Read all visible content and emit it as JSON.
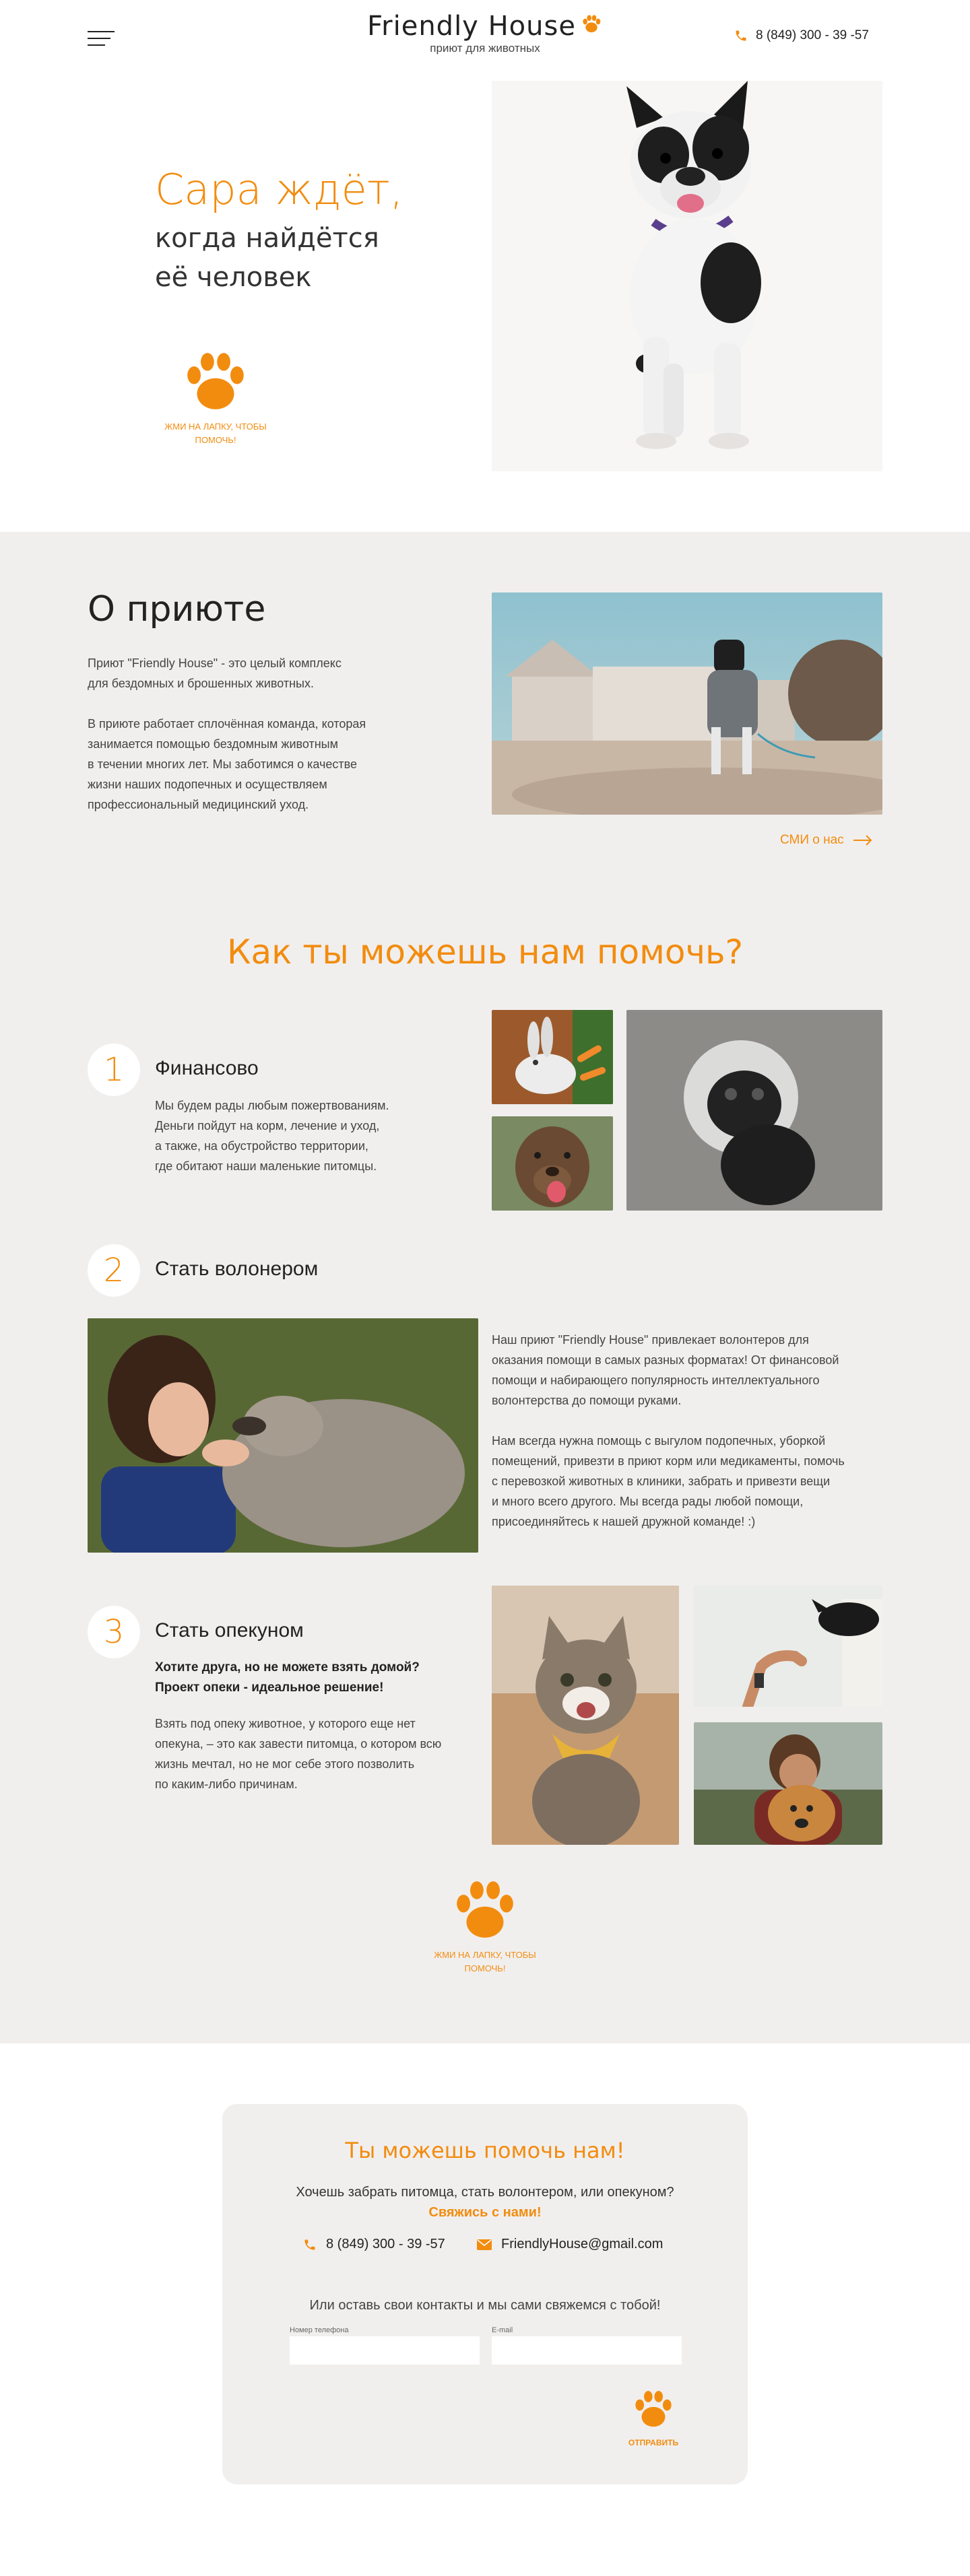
{
  "header": {
    "logo_title": "Friendly House",
    "logo_subtitle": "приют для животных",
    "phone": "8 (849) 300 - 39 -57",
    "menu_icon": "hamburger-icon",
    "phone_icon": "phone-icon"
  },
  "hero": {
    "title": "Сара ждёт,",
    "subtitle_line1": "когда найдётся",
    "subtitle_line2": "её человек",
    "paw_label_line1": "ЖМИ НА ЛАПКУ, ЧТОБЫ",
    "paw_label_line2": "ПОМОЧЬ!"
  },
  "about": {
    "title": "О приюте",
    "paragraph1_line1": "Приют \"Friendly House\" - это целый комплекс",
    "paragraph1_line2": "для бездомных и брошенных животных.",
    "paragraph2_line1": "В приюте работает сплочённая команда, которая",
    "paragraph2_line2": "занимается помощью бездомным животным",
    "paragraph2_line3": "в течении многих лет. Мы заботимся о качестве",
    "paragraph2_line4": "жизни наших подопечных и осуществляем",
    "paragraph2_line5": "профессиональный медицинский уход.",
    "media_link": "СМИ о нас"
  },
  "help": {
    "title": "Как ты можешь нам помочь?",
    "steps": [
      {
        "number": "1",
        "title": "Финансово",
        "text_line1": "Мы будем рады любым пожертвованиям.",
        "text_line2": "Деньги пойдут на корм, лечение и уход,",
        "text_line3": "а также, на обустройство территории,",
        "text_line4": "где обитают наши маленькие питомцы."
      },
      {
        "number": "2",
        "title": "Стать волонером",
        "p1_line1": "Наш приют \"Friendly House\" привлекает волонтеров для",
        "p1_line2": "оказания помощи в самых разных форматах! От финансовой",
        "p1_line3": "помощи и набирающего популярность интеллектуального",
        "p1_line4": "волонтерства до помощи руками.",
        "p2_line1": "Нам всегда нужна помощь с выгулом подопечных, уборкой",
        "p2_line2": "помещений, привезти в приют корм или медикаменты, помочь",
        "p2_line3": "с перевозкой животных в клиники, забрать и привезти вещи",
        "p2_line4": "и много всего другого. Мы всегда рады любой помощи,",
        "p2_line5": "присоединяйтесь к нашей дружной команде! :)"
      },
      {
        "number": "3",
        "title": "Стать опекуном",
        "bold_line1": "Хотите друга, но не можете взять домой?",
        "bold_line2": "Проект опеки - идеальное решение!",
        "text_line1": "Взять под опеку животное, у которого еще нет",
        "text_line2": "опекуна, – это как завести питомца, о котором всю",
        "text_line3": "жизнь мечтал, но не мог себе этого позволить",
        "text_line4": "по каким-либо причинам."
      }
    ],
    "paw_label_line1": "ЖМИ НА ЛАПКУ, ЧТОБЫ",
    "paw_label_line2": "ПОМОЧЬ!"
  },
  "contact": {
    "title": "Ты можешь помочь нам!",
    "question": "Хочешь забрать питомца, стать волонтером, или опекуном?",
    "link": "Свяжись с нами!",
    "phone": "8 (849) 300 - 39 -57",
    "email": "FriendlyHouse@gmail.com",
    "leave_text": "Или оставь свои контакты и мы сами свяжемся с тобой!",
    "phone_label": "Номер телефона",
    "phone_value": "",
    "email_label": "E-mail",
    "email_value": "",
    "submit_label": "ОТПРАВИТЬ"
  },
  "colors": {
    "accent": "#f28c0f",
    "section_bg": "#f1efee"
  }
}
